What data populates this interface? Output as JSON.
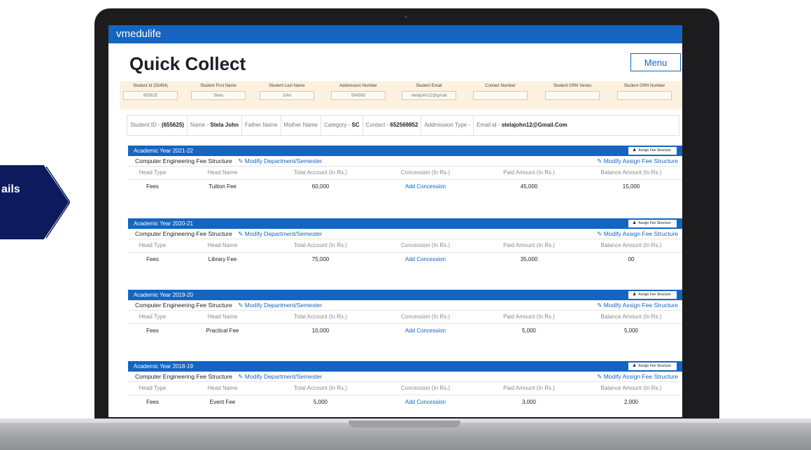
{
  "side_badge": {
    "text": "ails"
  },
  "app": {
    "brand": "vmedulife",
    "title": "Quick Collect",
    "menu_label": "Menu"
  },
  "search_fields": [
    {
      "label": "Student Id (55454)",
      "value": "655625"
    },
    {
      "label": "Student First Name",
      "value": "Stela"
    },
    {
      "label": "Student Last Name",
      "value": "John"
    },
    {
      "label": "Addmission Number",
      "value": "564565"
    },
    {
      "label": "Student Email",
      "value": "stelajohn12@gmail"
    },
    {
      "label": "Contact Number",
      "value": ""
    },
    {
      "label": "Student GRN Series",
      "value": ""
    },
    {
      "label": "Student GRN Number",
      "value": ""
    }
  ],
  "student_info": {
    "id_label": "Student ID - ",
    "id_value": "(655625)",
    "name_label": "Name - ",
    "name_value": "Stela John",
    "father": "Father Name",
    "mother": "Mother Name",
    "category_label": "Category - ",
    "category_value": "SC",
    "contact_label": "Contact - ",
    "contact_value": "652569852",
    "admission": "Addmission Type -",
    "email_label": "Email id - ",
    "email_value": "stelajohn12@Gmail.Com"
  },
  "labels": {
    "assign_fee": "Assign Fee Structure",
    "structure": "Computer Engineering Fee Structure",
    "modify_dept": "Modify Department/Semester",
    "modify_assign": "Modify Assign Fee Structure",
    "col_head_type": "Head Type",
    "col_head_name": "Head Name",
    "col_total": "Total Account (In Rs.)",
    "col_concession": "Concession (In Rs.)",
    "col_paid": "Paid Amount (In Rs.)",
    "col_balance": "Balance Amount (In Rs.)"
  },
  "years": [
    {
      "title": "Academic Year 2021-22",
      "row": {
        "type": "Fees",
        "name": "Tuition Fee",
        "total": "60,000",
        "concession": "Add Concession",
        "paid": "45,000",
        "balance": "15,000"
      }
    },
    {
      "title": "Academic Year 2020-21",
      "row": {
        "type": "Fees",
        "name": "Library Fee",
        "total": "75,000",
        "concession": "Add Concession",
        "paid": "35,000",
        "balance": "00"
      }
    },
    {
      "title": "Academic Year 2019-20",
      "row": {
        "type": "Fees",
        "name": "Practical Fee",
        "total": "10,000",
        "concession": "Add Concession",
        "paid": "5,000",
        "balance": "5,000"
      }
    },
    {
      "title": "Academic Year 2018-19",
      "row": {
        "type": "Fees",
        "name": "Event Fee",
        "total": "5,000",
        "concession": "Add Concession",
        "paid": "3,000",
        "balance": "2,000"
      }
    }
  ],
  "colors": {
    "brand_blue": "#1565c0",
    "badge_navy": "#0d1b5e",
    "search_panel": "#fdf2df",
    "bezel": "#1c1c1e"
  }
}
